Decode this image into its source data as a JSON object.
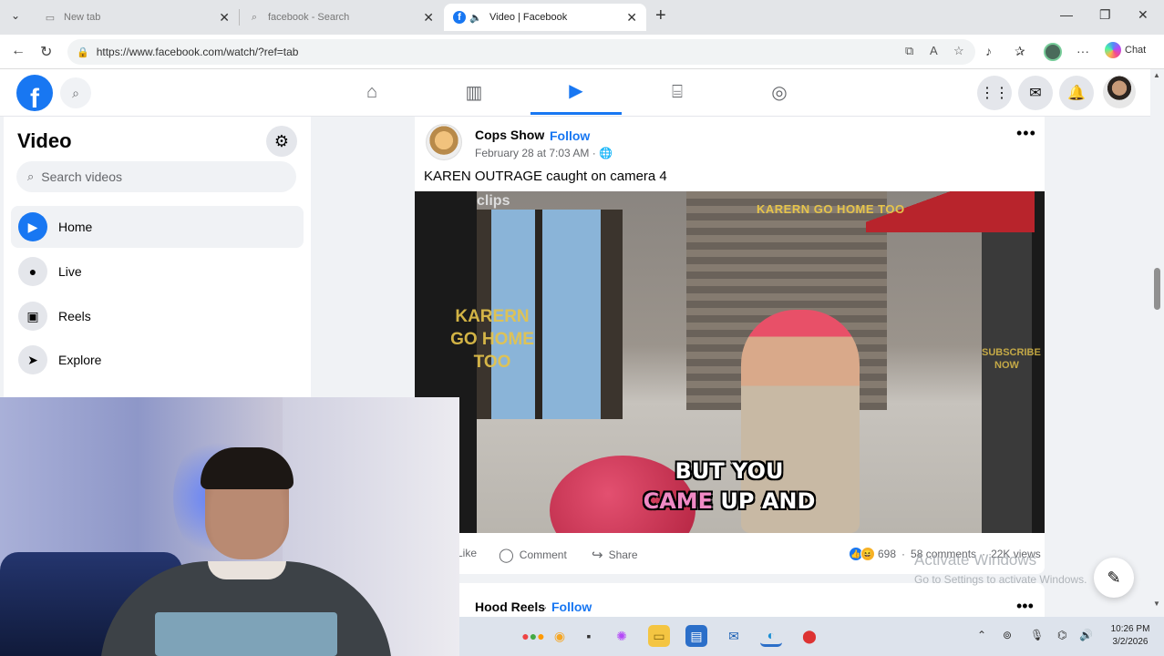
{
  "browser": {
    "tabs": [
      {
        "title": "New tab",
        "active": false
      },
      {
        "title": "facebook - Search",
        "active": false
      },
      {
        "title": "Video | Facebook",
        "active": true
      }
    ],
    "url": "https://www.facebook.com/watch/?ref=tab",
    "copilot_label": "Chat",
    "icons": [
      "back-arrow-icon",
      "reload-icon",
      "lock-icon",
      "new-tab-plus-icon",
      "minimize-icon",
      "restore-icon",
      "close-window-icon"
    ]
  },
  "fb_nav": {
    "logo": "f",
    "tabs": [
      "home-icon",
      "dashboard-icon",
      "video-icon",
      "marketplace-icon",
      "groups-icon"
    ],
    "active_tab": 2,
    "right_buttons": [
      "menu-grid-icon",
      "messenger-icon",
      "notifications-icon"
    ]
  },
  "sidebar": {
    "title": "Video",
    "search_placeholder": "Search videos",
    "items": [
      {
        "label": "Home",
        "icon": "▶",
        "active": true
      },
      {
        "label": "Live",
        "icon": "●",
        "active": false
      },
      {
        "label": "Reels",
        "icon": "▣",
        "active": false
      },
      {
        "label": "Explore",
        "icon": "➤",
        "active": false
      }
    ]
  },
  "post": {
    "author": "Cops Show",
    "separator": "·",
    "follow": "Follow",
    "date": "February 28 at 7:03 AM · ",
    "more": "•••",
    "text": "KAREN OUTRAGE caught on camera 4",
    "video": {
      "watermark_top": "clips",
      "tag_top_right": "KARERN GO HOME TOO",
      "tag_left": "KARERN GO HOME TOO",
      "subscribe": "SUBSCRIBE NOW",
      "subtitle_line1": "BUT YOU",
      "subtitle_hl": "CAME",
      "subtitle_rest": " UP AND"
    },
    "actions": {
      "like": "Like",
      "comment": "Comment",
      "share": "Share",
      "reactions": "698",
      "comments": "58 comments",
      "views": "22K views",
      "stats_sep": "·"
    }
  },
  "post2": {
    "author": "Hood Reels",
    "separator": "·",
    "follow": "Follow",
    "more": "•••"
  },
  "watermark": {
    "line1": "Activate Windows",
    "line2": "Go to Settings to activate Windows."
  },
  "taskbar": {
    "time": "10:26 PM",
    "date": "3/2/2026"
  },
  "colors": {
    "fb_blue": "#1877f2",
    "background": "#f0f2f5"
  }
}
